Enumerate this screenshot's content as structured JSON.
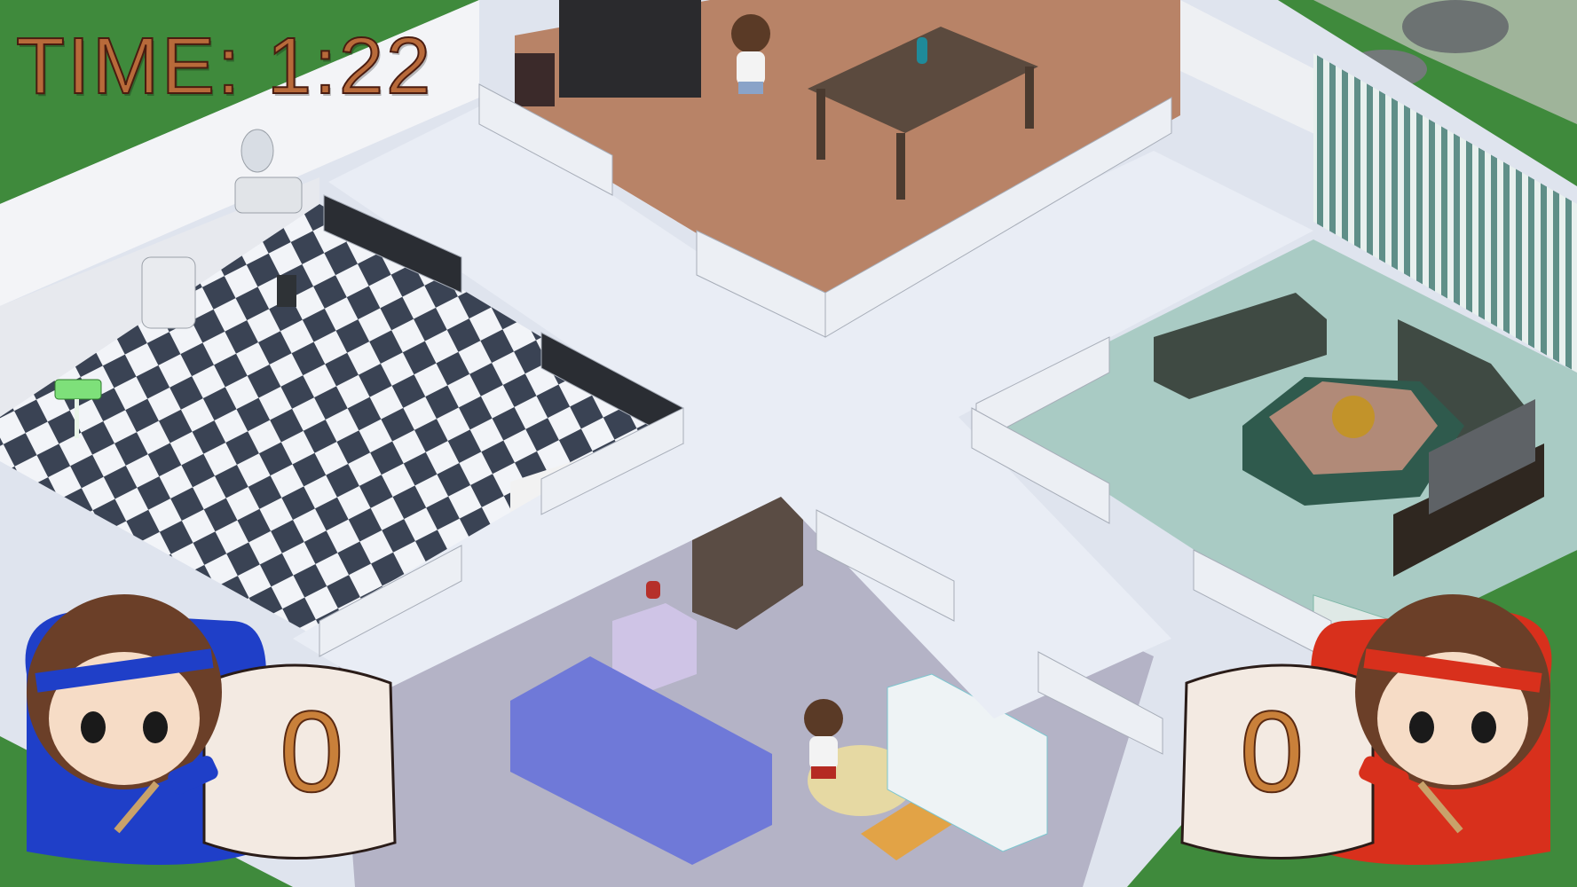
{
  "hud": {
    "timer_text": "TIME: 1:22"
  },
  "players": [
    {
      "side": "left",
      "score": "0",
      "team_color": "#1f3fc8"
    },
    {
      "side": "right",
      "score": "0",
      "team_color": "#d8301c"
    }
  ],
  "colors": {
    "grass": "#3f8a3c",
    "hallway": "#e9edf5",
    "dining_floor": "#b88367",
    "living_floor": "#a9cbc4",
    "bedroom_floor": "#b4b3c6",
    "bath_dark_tile": "#3a4354",
    "bath_light_tile": "#f2f4f8"
  }
}
